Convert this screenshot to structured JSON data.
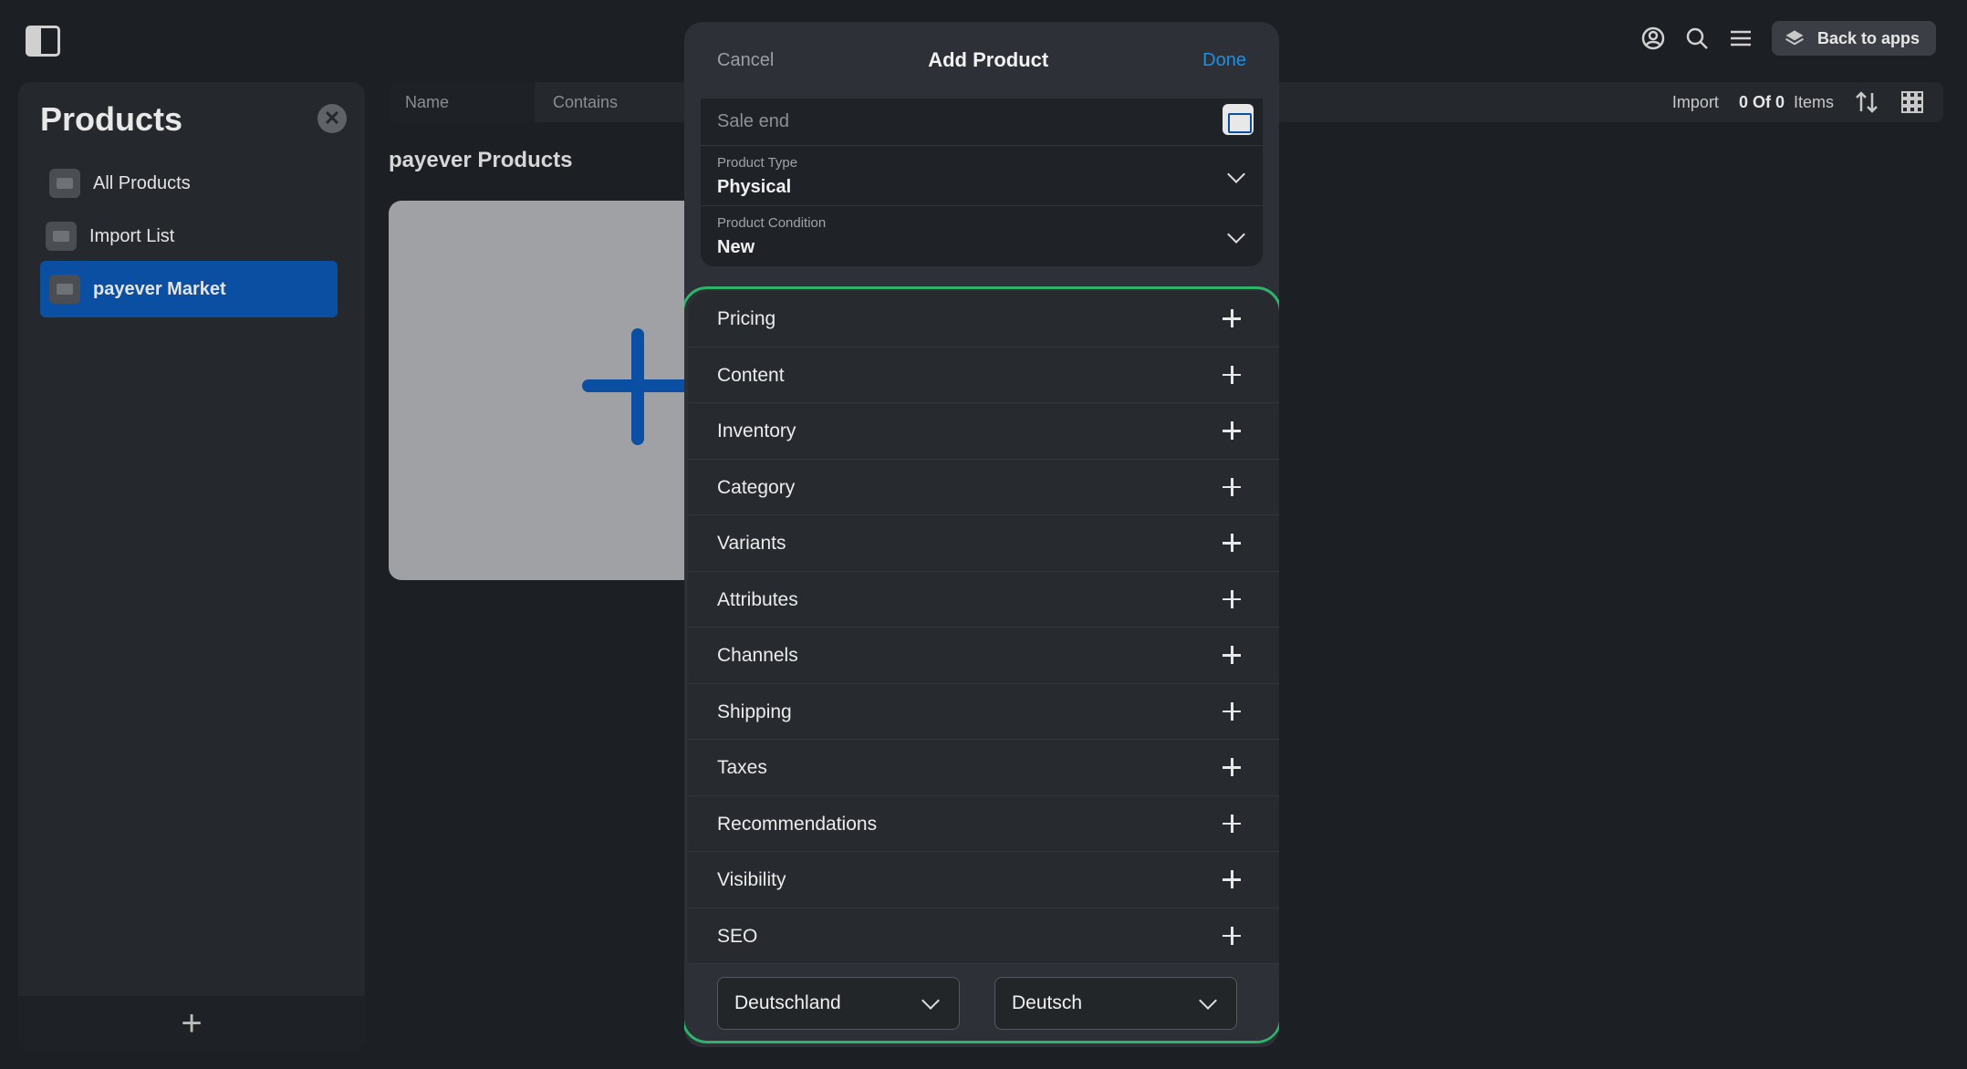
{
  "topbar": {
    "back_label": "Back to apps",
    "icons": [
      "sidebar-toggle-icon",
      "account-icon",
      "search-icon",
      "menu-icon",
      "layers-icon"
    ]
  },
  "sidebar": {
    "title": "Products",
    "items": [
      {
        "label": "All Products",
        "active": false
      },
      {
        "label": "Import List",
        "active": false
      },
      {
        "label": "payever Market",
        "active": true
      }
    ],
    "footer_add": "+"
  },
  "filterbar": {
    "name": "Name",
    "contains": "Contains",
    "import": "Import",
    "count": "0 Of 0",
    "items": "Items"
  },
  "main": {
    "section_title": "payever Products"
  },
  "modal": {
    "cancel": "Cancel",
    "title": "Add Product",
    "done": "Done",
    "sale_end": "Sale end",
    "product_type_label": "Product Type",
    "product_type_value": "Physical",
    "product_condition_label": "Product Condition",
    "product_condition_value": "New",
    "sections": [
      "Pricing",
      "Content",
      "Inventory",
      "Category",
      "Variants",
      "Attributes",
      "Channels",
      "Shipping",
      "Taxes",
      "Recommendations",
      "Visibility",
      "SEO"
    ],
    "country": "Deutschland",
    "language": "Deutsch"
  },
  "colors": {
    "accent": "#0b4fa3",
    "done": "#1e8fe1",
    "highlight": "#2fb36b"
  }
}
